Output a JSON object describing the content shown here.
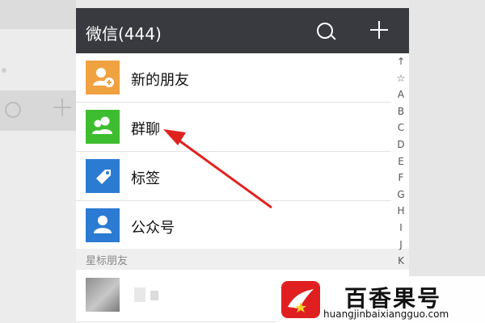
{
  "header": {
    "title": "微信(444)"
  },
  "list": {
    "items": [
      {
        "label": "新的朋友",
        "icon": "add-friend-icon",
        "color": "#f0a140"
      },
      {
        "label": "群聊",
        "icon": "group-chat-icon",
        "color": "#3dbd2f"
      },
      {
        "label": "标签",
        "icon": "tag-icon",
        "color": "#2b7bd3"
      },
      {
        "label": "公众号",
        "icon": "official-account-icon",
        "color": "#2b7bd3"
      }
    ]
  },
  "section": {
    "title": "星标朋友"
  },
  "index_letters": [
    "↑",
    "☆",
    "A",
    "B",
    "C",
    "D",
    "E",
    "F",
    "G",
    "H",
    "I",
    "J",
    "K"
  ],
  "watermark": {
    "title": "百香果号",
    "url": "huangjinbaixiangguo.com"
  },
  "colors": {
    "header_bg": "#393a3f",
    "arrow": "#e0221f"
  }
}
